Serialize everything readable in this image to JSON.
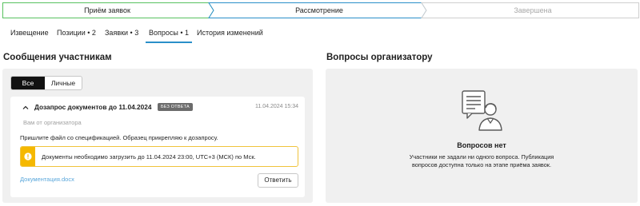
{
  "stepper": {
    "steps": [
      {
        "label": "Приём заявок",
        "state": "done"
      },
      {
        "label": "Рассмотрение",
        "state": "current"
      },
      {
        "label": "Завершена",
        "state": "upcoming"
      }
    ],
    "colors": {
      "done": "#58c15f",
      "current": "#2a8fc9",
      "upcoming": "#cfcfcf"
    }
  },
  "tabs": [
    {
      "label": "Извещение"
    },
    {
      "label": "Позиции • 2"
    },
    {
      "label": "Заявки • 3"
    },
    {
      "label": "Вопросы • 1",
      "active": true
    },
    {
      "label": "История изменений"
    }
  ],
  "left": {
    "title": "Сообщения участникам",
    "filter": {
      "all": "Все",
      "personal": "Личные"
    },
    "message": {
      "title": "Дозапрос документов до 11.04.2024",
      "badge": "БЕЗ ОТВЕТА",
      "date": "11.04.2024 15:34",
      "from": "Вам от организатора",
      "text": "Пришлите файл со спецификацией. Образец прикрепляю к дозапросу.",
      "warning": "Документы необходимо загрузить до 11.04.2024 23:00, UTC+3 (МСК) по Мск.",
      "attachment": "Документация.docx",
      "reply": "Ответить"
    }
  },
  "right": {
    "title": "Вопросы организатору",
    "empty_title": "Вопросов нет",
    "empty_text_1": "Участники не задали ни одного вопроса. Публикация",
    "empty_text_2": "вопросов доступна только на этапе приёма заявок."
  }
}
